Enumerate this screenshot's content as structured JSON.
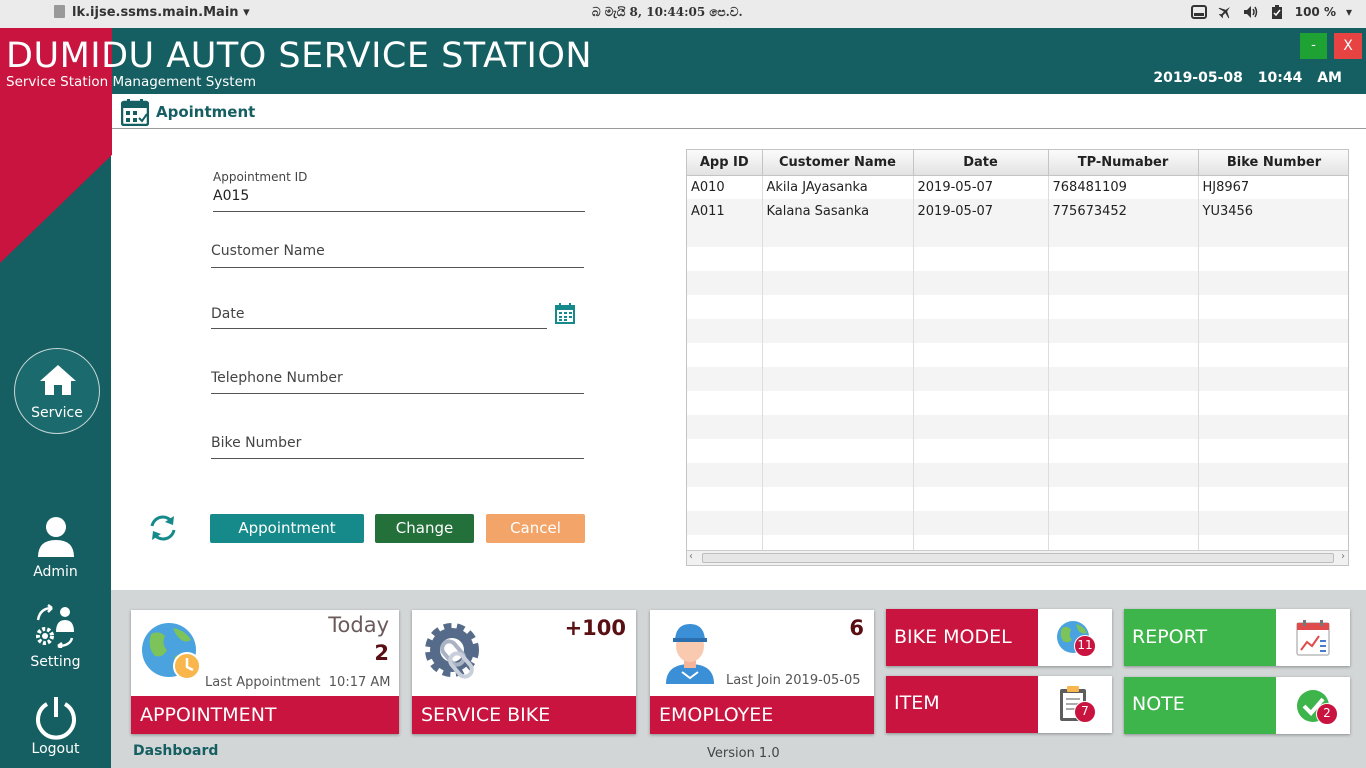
{
  "system_bar": {
    "app_name": "lk.ijse.ssms.main.Main",
    "clock": "බ මැයි 8, 10:44:05 පෙ.ව.",
    "battery": "100 %"
  },
  "header": {
    "title": "DUMIDU AUTO SERVICE STATION",
    "subtitle": "Service Station Management System",
    "date": "2019-05-08",
    "time": "10:44 AM",
    "minimize_label": "-",
    "close_label": "X"
  },
  "sidebar": {
    "service": "Service",
    "admin": "Admin",
    "setting": "Setting",
    "logout": "Logout"
  },
  "panel": {
    "title": "Apointment"
  },
  "form": {
    "appointment_id_label": "Appointment ID",
    "appointment_id_value": "A015",
    "customer_name_label": "Customer Name",
    "date_label": "Date",
    "telephone_label": "Telephone Number",
    "bike_number_label": "Bike Number"
  },
  "buttons": {
    "appointment": "Appointment",
    "change": "Change",
    "cancel": "Cancel"
  },
  "table": {
    "columns": [
      "App ID",
      "Customer Name",
      "Date",
      "TP-Numaber",
      "Bike Number"
    ],
    "rows": [
      [
        "A010",
        "Akila JAyasanka",
        "2019-05-07",
        "768481109",
        "HJ8967"
      ],
      [
        "A011",
        "Kalana Sasanka",
        "2019-05-07",
        "775673452",
        "YU3456"
      ]
    ]
  },
  "dashboard": {
    "appointment": {
      "label": "APPOINTMENT",
      "today_label": "Today",
      "count": "2",
      "last_label": "Last Appointment",
      "last_value": "10:17 AM"
    },
    "service_bike": {
      "label": "SERVICE BIKE",
      "count": "+100"
    },
    "employee": {
      "label": "EMOPLOYEE",
      "count": "6",
      "last_label": "Last Join",
      "last_value": "2019-05-05"
    },
    "bike_model": {
      "label": "BIKE MODEL",
      "badge": "11"
    },
    "item": {
      "label": "ITEM",
      "badge": "7"
    },
    "report": {
      "label": "REPORT"
    },
    "note": {
      "label": "NOTE",
      "badge": "2"
    },
    "link": "Dashboard",
    "version": "Version 1.0"
  },
  "colors": {
    "teal": "#155f62",
    "crimson": "#c8143e",
    "green": "#3db54a",
    "appointment_btn": "#168a8a",
    "change_btn": "#23703a",
    "cancel_btn": "#f3a468"
  }
}
